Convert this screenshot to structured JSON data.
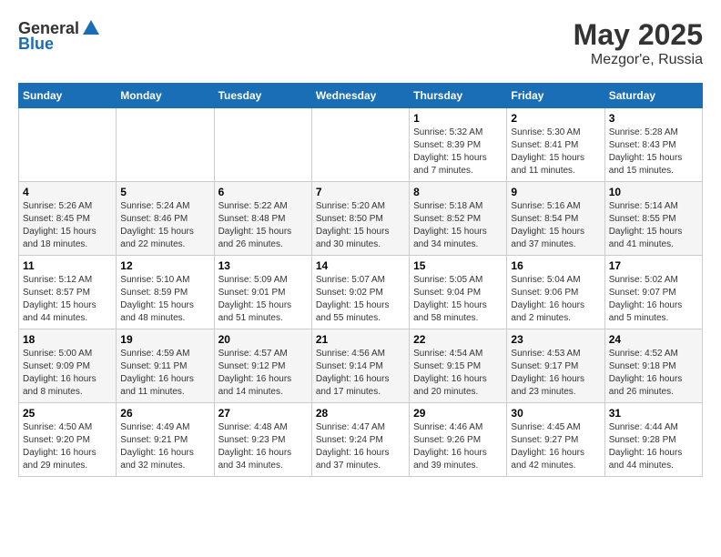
{
  "header": {
    "logo_general": "General",
    "logo_blue": "Blue",
    "title": "May 2025",
    "location": "Mezgor'e, Russia"
  },
  "weekdays": [
    "Sunday",
    "Monday",
    "Tuesday",
    "Wednesday",
    "Thursday",
    "Friday",
    "Saturday"
  ],
  "weeks": [
    [
      null,
      null,
      null,
      null,
      {
        "day": "1",
        "sunrise": "Sunrise: 5:32 AM",
        "sunset": "Sunset: 8:39 PM",
        "daylight": "Daylight: 15 hours and 7 minutes."
      },
      {
        "day": "2",
        "sunrise": "Sunrise: 5:30 AM",
        "sunset": "Sunset: 8:41 PM",
        "daylight": "Daylight: 15 hours and 11 minutes."
      },
      {
        "day": "3",
        "sunrise": "Sunrise: 5:28 AM",
        "sunset": "Sunset: 8:43 PM",
        "daylight": "Daylight: 15 hours and 15 minutes."
      }
    ],
    [
      {
        "day": "4",
        "sunrise": "Sunrise: 5:26 AM",
        "sunset": "Sunset: 8:45 PM",
        "daylight": "Daylight: 15 hours and 18 minutes."
      },
      {
        "day": "5",
        "sunrise": "Sunrise: 5:24 AM",
        "sunset": "Sunset: 8:46 PM",
        "daylight": "Daylight: 15 hours and 22 minutes."
      },
      {
        "day": "6",
        "sunrise": "Sunrise: 5:22 AM",
        "sunset": "Sunset: 8:48 PM",
        "daylight": "Daylight: 15 hours and 26 minutes."
      },
      {
        "day": "7",
        "sunrise": "Sunrise: 5:20 AM",
        "sunset": "Sunset: 8:50 PM",
        "daylight": "Daylight: 15 hours and 30 minutes."
      },
      {
        "day": "8",
        "sunrise": "Sunrise: 5:18 AM",
        "sunset": "Sunset: 8:52 PM",
        "daylight": "Daylight: 15 hours and 34 minutes."
      },
      {
        "day": "9",
        "sunrise": "Sunrise: 5:16 AM",
        "sunset": "Sunset: 8:54 PM",
        "daylight": "Daylight: 15 hours and 37 minutes."
      },
      {
        "day": "10",
        "sunrise": "Sunrise: 5:14 AM",
        "sunset": "Sunset: 8:55 PM",
        "daylight": "Daylight: 15 hours and 41 minutes."
      }
    ],
    [
      {
        "day": "11",
        "sunrise": "Sunrise: 5:12 AM",
        "sunset": "Sunset: 8:57 PM",
        "daylight": "Daylight: 15 hours and 44 minutes."
      },
      {
        "day": "12",
        "sunrise": "Sunrise: 5:10 AM",
        "sunset": "Sunset: 8:59 PM",
        "daylight": "Daylight: 15 hours and 48 minutes."
      },
      {
        "day": "13",
        "sunrise": "Sunrise: 5:09 AM",
        "sunset": "Sunset: 9:01 PM",
        "daylight": "Daylight: 15 hours and 51 minutes."
      },
      {
        "day": "14",
        "sunrise": "Sunrise: 5:07 AM",
        "sunset": "Sunset: 9:02 PM",
        "daylight": "Daylight: 15 hours and 55 minutes."
      },
      {
        "day": "15",
        "sunrise": "Sunrise: 5:05 AM",
        "sunset": "Sunset: 9:04 PM",
        "daylight": "Daylight: 15 hours and 58 minutes."
      },
      {
        "day": "16",
        "sunrise": "Sunrise: 5:04 AM",
        "sunset": "Sunset: 9:06 PM",
        "daylight": "Daylight: 16 hours and 2 minutes."
      },
      {
        "day": "17",
        "sunrise": "Sunrise: 5:02 AM",
        "sunset": "Sunset: 9:07 PM",
        "daylight": "Daylight: 16 hours and 5 minutes."
      }
    ],
    [
      {
        "day": "18",
        "sunrise": "Sunrise: 5:00 AM",
        "sunset": "Sunset: 9:09 PM",
        "daylight": "Daylight: 16 hours and 8 minutes."
      },
      {
        "day": "19",
        "sunrise": "Sunrise: 4:59 AM",
        "sunset": "Sunset: 9:11 PM",
        "daylight": "Daylight: 16 hours and 11 minutes."
      },
      {
        "day": "20",
        "sunrise": "Sunrise: 4:57 AM",
        "sunset": "Sunset: 9:12 PM",
        "daylight": "Daylight: 16 hours and 14 minutes."
      },
      {
        "day": "21",
        "sunrise": "Sunrise: 4:56 AM",
        "sunset": "Sunset: 9:14 PM",
        "daylight": "Daylight: 16 hours and 17 minutes."
      },
      {
        "day": "22",
        "sunrise": "Sunrise: 4:54 AM",
        "sunset": "Sunset: 9:15 PM",
        "daylight": "Daylight: 16 hours and 20 minutes."
      },
      {
        "day": "23",
        "sunrise": "Sunrise: 4:53 AM",
        "sunset": "Sunset: 9:17 PM",
        "daylight": "Daylight: 16 hours and 23 minutes."
      },
      {
        "day": "24",
        "sunrise": "Sunrise: 4:52 AM",
        "sunset": "Sunset: 9:18 PM",
        "daylight": "Daylight: 16 hours and 26 minutes."
      }
    ],
    [
      {
        "day": "25",
        "sunrise": "Sunrise: 4:50 AM",
        "sunset": "Sunset: 9:20 PM",
        "daylight": "Daylight: 16 hours and 29 minutes."
      },
      {
        "day": "26",
        "sunrise": "Sunrise: 4:49 AM",
        "sunset": "Sunset: 9:21 PM",
        "daylight": "Daylight: 16 hours and 32 minutes."
      },
      {
        "day": "27",
        "sunrise": "Sunrise: 4:48 AM",
        "sunset": "Sunset: 9:23 PM",
        "daylight": "Daylight: 16 hours and 34 minutes."
      },
      {
        "day": "28",
        "sunrise": "Sunrise: 4:47 AM",
        "sunset": "Sunset: 9:24 PM",
        "daylight": "Daylight: 16 hours and 37 minutes."
      },
      {
        "day": "29",
        "sunrise": "Sunrise: 4:46 AM",
        "sunset": "Sunset: 9:26 PM",
        "daylight": "Daylight: 16 hours and 39 minutes."
      },
      {
        "day": "30",
        "sunrise": "Sunrise: 4:45 AM",
        "sunset": "Sunset: 9:27 PM",
        "daylight": "Daylight: 16 hours and 42 minutes."
      },
      {
        "day": "31",
        "sunrise": "Sunrise: 4:44 AM",
        "sunset": "Sunset: 9:28 PM",
        "daylight": "Daylight: 16 hours and 44 minutes."
      }
    ]
  ]
}
